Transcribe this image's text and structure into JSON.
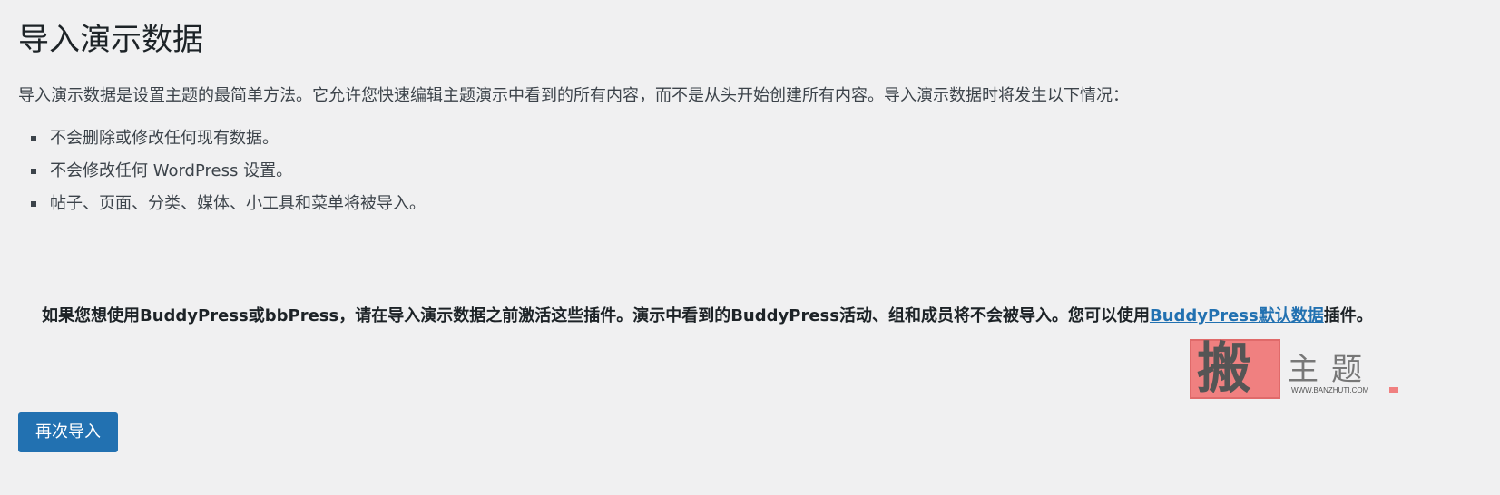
{
  "page": {
    "title": "导入演示数据",
    "intro": "导入演示数据是设置主题的最简单方法。它允许您快速编辑主题演示中看到的所有内容，而不是从头开始创建所有内容。导入演示数据时将发生以下情况：",
    "effects": [
      "不会删除或修改任何现有数据。",
      "不会修改任何 WordPress 设置。",
      "帖子、页面、分类、媒体、小工具和菜单将被导入。"
    ],
    "notice": {
      "text_before": "如果您想使用BuddyPress或bbPress，请在导入演示数据之前激活这些插件。演示中看到的BuddyPress活动、组和成员将不会被导入。您可以使用",
      "link_text": "BuddyPress默认数据",
      "text_after": "插件。"
    },
    "reimport_button": "再次导入"
  },
  "watermark": {
    "char": "搬",
    "title": "主题",
    "url": "WWW.BANZHUTI.COM"
  },
  "colors": {
    "background": "#f0f0f1",
    "text": "#3c434a",
    "primary": "#2271b1",
    "watermark_accent": "#f08080"
  }
}
